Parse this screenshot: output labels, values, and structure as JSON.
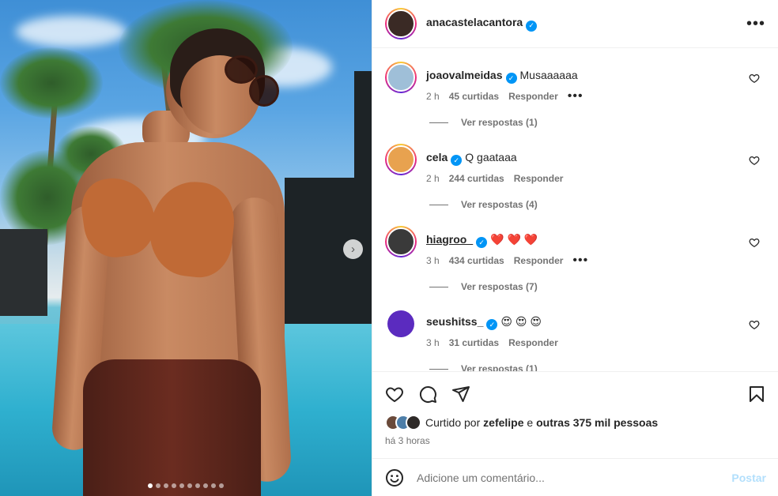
{
  "post": {
    "image_indicator": {
      "total": 10,
      "active": 0
    }
  },
  "header": {
    "username": "anacastelacantora",
    "verified_badge": "✓",
    "more_options": "•••"
  },
  "comments": [
    {
      "username": "joaovalmeidas",
      "verified": true,
      "text": "Musaaaaaa",
      "time": "2 h",
      "likes": "45 curtidas",
      "reply": "Responder",
      "more": "•••",
      "view_replies": "Ver respostas (1)",
      "avatar_color": "#9fbfd8"
    },
    {
      "username": "cela",
      "verified": true,
      "text": "Q gaataaa",
      "time": "2 h",
      "likes": "244 curtidas",
      "reply": "Responder",
      "more": "",
      "view_replies": "Ver respostas (4)",
      "avatar_color": "#e8a24f"
    },
    {
      "username": "hiagroo_",
      "verified": true,
      "text": "❤️ ❤️ ❤️",
      "time": "3 h",
      "likes": "434 curtidas",
      "reply": "Responder",
      "more": "•••",
      "view_replies": "Ver respostas (7)",
      "avatar_color": "#3a3a3a"
    },
    {
      "username": "seushitss_",
      "verified": true,
      "text": "😍 😍 😍",
      "time": "3 h",
      "likes": "31 curtidas",
      "reply": "Responder",
      "more": "",
      "view_replies": "Ver respostas (1)",
      "avatar_color": "#5b2bbf"
    }
  ],
  "actions": {
    "liked_by_prefix": "Curtido por",
    "liked_by_user": "zefelipe",
    "liked_by_and": "e",
    "liked_by_others": "outras 375 mil pessoas",
    "time_ago": "há 3 horas"
  },
  "add_comment": {
    "placeholder": "Adicione um comentário...",
    "post_label": "Postar"
  },
  "colors": {
    "verified": "#0095f6",
    "post_button_disabled": "#b2dffc",
    "meta_text": "#737373"
  }
}
